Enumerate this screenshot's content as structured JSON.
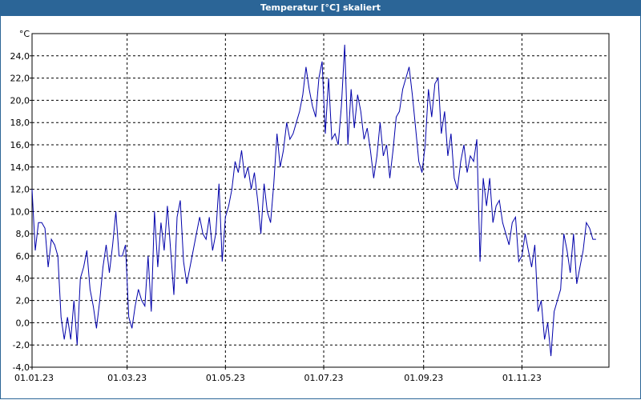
{
  "window": {
    "title": "Temperatur [°C] skaliert"
  },
  "chart_data": {
    "type": "line",
    "title": "Temperatur [°C] skaliert",
    "ylabel": "°C",
    "xlabel": "",
    "ylim": [
      -4.0,
      26.0
    ],
    "y_ticks": [
      "-4,0",
      "-2,0",
      "0,0",
      "2,0",
      "4,0",
      "6,0",
      "8,0",
      "10,0",
      "12,0",
      "14,0",
      "16,0",
      "18,0",
      "20,0",
      "22,0",
      "24,0"
    ],
    "x_ticks": [
      "01.01.23",
      "01.03.23",
      "01.05.23",
      "01.07.23",
      "01.09.23",
      "01.11.23"
    ],
    "x_tick_days": [
      0,
      59,
      120,
      181,
      243,
      304
    ],
    "x_range_days": [
      0,
      358
    ],
    "grid": true,
    "series_color": "#0000aa",
    "series": [
      {
        "x_days": [
          0,
          2,
          4,
          6,
          8,
          10,
          12,
          14,
          16,
          18,
          20,
          22,
          24,
          26,
          28,
          30,
          32,
          34,
          36,
          38,
          40,
          42,
          44,
          46,
          48,
          50,
          52,
          54,
          56,
          58,
          60,
          62,
          64,
          66,
          68,
          70,
          72,
          74,
          76,
          78,
          80,
          82,
          84,
          86,
          88,
          90,
          92,
          94,
          96,
          98,
          100,
          102,
          104,
          106,
          108,
          110,
          112,
          114,
          116,
          118,
          120,
          122,
          124,
          126,
          128,
          130,
          132,
          134,
          136,
          138,
          140,
          142,
          144,
          146,
          148,
          150,
          152,
          154,
          156,
          158,
          160,
          162,
          164,
          166,
          168,
          170,
          172,
          174,
          176,
          178,
          180,
          182,
          184,
          186,
          188,
          190,
          192,
          194,
          196,
          198,
          200,
          202,
          204,
          206,
          208,
          210,
          212,
          214,
          216,
          218,
          220,
          222,
          224,
          226,
          228,
          230,
          232,
          234,
          236,
          238,
          240,
          242,
          244,
          246,
          248,
          250,
          252,
          254,
          256,
          258,
          260,
          262,
          264,
          266,
          268,
          270,
          272,
          274,
          276,
          278,
          280,
          282,
          284,
          286,
          288,
          290,
          292,
          294,
          296,
          298,
          300,
          302,
          304,
          306,
          308,
          310,
          312,
          314,
          316,
          318,
          320,
          322,
          324,
          326,
          328,
          330,
          332,
          334,
          336,
          338,
          340,
          342,
          344,
          346,
          348,
          350,
          352,
          354,
          356,
          358
        ],
        "values": [
          12.0,
          6.5,
          9.0,
          9.0,
          8.5,
          5.0,
          7.5,
          7.0,
          6.0,
          0.5,
          -1.5,
          0.5,
          -1.5,
          2.0,
          -2.0,
          4.0,
          5.0,
          6.5,
          3.0,
          1.5,
          -0.5,
          2.0,
          5.0,
          7.0,
          4.5,
          7.0,
          10.0,
          6.0,
          6.0,
          7.0,
          0.5,
          -0.5,
          1.5,
          3.0,
          2.0,
          1.5,
          6.0,
          1.0,
          10.0,
          5.0,
          9.0,
          6.5,
          10.5,
          6.5,
          2.5,
          9.5,
          11.0,
          5.5,
          3.5,
          5.0,
          6.5,
          8.0,
          9.5,
          8.0,
          7.5,
          9.5,
          6.5,
          8.0,
          12.5,
          5.5,
          9.5,
          10.5,
          12.0,
          14.5,
          13.5,
          15.5,
          13.0,
          14.0,
          12.0,
          13.5,
          11.0,
          8.0,
          12.5,
          10.0,
          9.0,
          12.5,
          17.0,
          14.0,
          15.5,
          18.0,
          16.5,
          17.0,
          18.0,
          19.0,
          20.5,
          23.0,
          21.0,
          19.5,
          18.5,
          22.0,
          23.5,
          17.0,
          22.0,
          16.5,
          17.0,
          16.0,
          19.5,
          25.0,
          16.0,
          21.0,
          17.5,
          20.5,
          19.0,
          16.5,
          17.5,
          15.5,
          13.0,
          15.0,
          18.0,
          15.0,
          16.0,
          13.0,
          15.5,
          18.5,
          19.0,
          21.0,
          22.0,
          23.0,
          20.5,
          17.5,
          14.5,
          13.5,
          16.0,
          21.0,
          18.5,
          21.5,
          22.0,
          17.0,
          19.0,
          15.0,
          17.0,
          13.0,
          12.0,
          14.5,
          16.0,
          13.5,
          15.0,
          14.5,
          16.5,
          5.5,
          13.0,
          10.5,
          13.0,
          9.0,
          10.5,
          11.0,
          9.0,
          8.0,
          7.0,
          9.0,
          9.5,
          5.5,
          6.0,
          8.0,
          6.5,
          5.0,
          7.0,
          1.0,
          2.0,
          -1.5,
          0.0,
          -3.0,
          1.0,
          2.0,
          3.0,
          8.0,
          6.5,
          4.5,
          8.0,
          3.5,
          5.0,
          6.5,
          9.0,
          8.5,
          7.5,
          7.5
        ]
      }
    ]
  }
}
